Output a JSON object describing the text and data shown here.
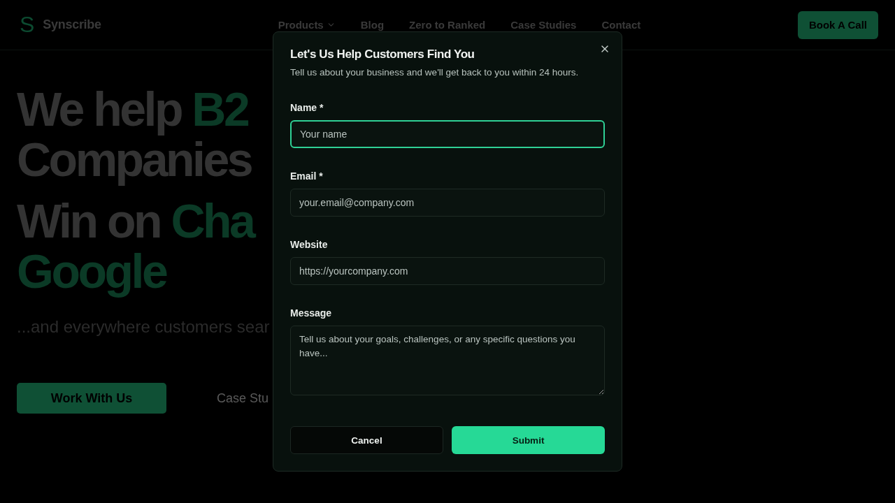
{
  "nav": {
    "brand": "Synscribe",
    "logo_letter": "S",
    "links": [
      {
        "label": "Products",
        "dropdown": true
      },
      {
        "label": "Blog",
        "dropdown": false
      },
      {
        "label": "Zero to Ranked",
        "dropdown": false
      },
      {
        "label": "Case Studies",
        "dropdown": false
      },
      {
        "label": "Contact",
        "dropdown": false
      }
    ],
    "cta": "Book A Call"
  },
  "hero": {
    "headline": [
      [
        {
          "text": "We help ",
          "accent": false
        },
        {
          "text": "B2",
          "accent": true
        }
      ],
      [
        {
          "text": "Companies",
          "accent": false
        }
      ],
      [
        {
          "text": "Win on ",
          "accent": false
        },
        {
          "text": "Cha",
          "accent": true
        }
      ],
      [
        {
          "text": "Google",
          "accent": true
        }
      ]
    ],
    "subtitle": "...and everywhere customers sear",
    "primary_button": "Work With Us",
    "secondary_button": "Case Stu"
  },
  "modal": {
    "title": "Let's Us Help Customers Find You",
    "description": "Tell us about your business and we'll get back to you within 24 hours.",
    "fields": [
      {
        "label": "Name *",
        "placeholder": "Your name",
        "kind": "input",
        "focused": true
      },
      {
        "label": "Email *",
        "placeholder": "your.email@company.com",
        "kind": "input",
        "focused": false
      },
      {
        "label": "Website",
        "placeholder": "https://yourcompany.com",
        "kind": "input",
        "focused": false
      },
      {
        "label": "Message",
        "placeholder": "Tell us about your goals, challenges, or any specific questions you have...",
        "kind": "textarea",
        "focused": false
      }
    ],
    "cancel": "Cancel",
    "submit": "Submit"
  }
}
